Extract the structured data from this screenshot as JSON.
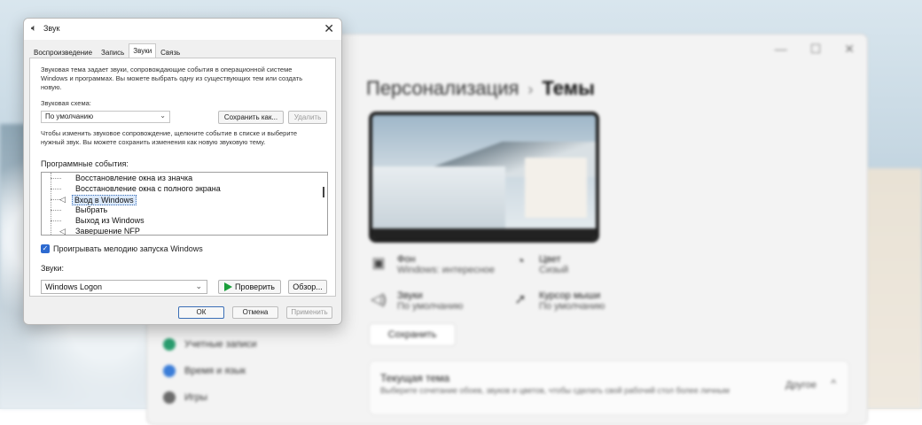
{
  "settings": {
    "breadcrumb_parent": "Персонализация",
    "breadcrumb_sep": "›",
    "breadcrumb_current": "Темы",
    "window_controls": [
      "—",
      "☐",
      "✕"
    ],
    "tiles": [
      {
        "title": "Фон",
        "value": "Windows: интересное",
        "icon": "image-icon"
      },
      {
        "title": "Цвет",
        "value": "Сизый",
        "icon": "palette-icon"
      },
      {
        "title": "Звуки",
        "value": "По умолчанию",
        "icon": "speaker-icon"
      },
      {
        "title": "Курсор мыши",
        "value": "По умолчанию",
        "icon": "cursor-icon"
      }
    ],
    "save_button": "Сохранить",
    "current_theme": {
      "title": "Текущая тема",
      "subtitle": "Выберите сочетание обоев, звуков и цветов, чтобы сделать свой рабочий стол более личным",
      "value": "Другое",
      "chevron": "^"
    },
    "nav": [
      {
        "label": "Учетные записи",
        "color": "#2a9d6f"
      },
      {
        "label": "Время и язык",
        "color": "#3b7dd8"
      },
      {
        "label": "Игры",
        "color": "#6b6b6b"
      }
    ]
  },
  "dialog": {
    "title": "Звук",
    "close_glyph": "✕",
    "tabs": [
      "Воспроизведение",
      "Запись",
      "Звуки",
      "Связь"
    ],
    "selected_tab": 2,
    "intro": "Звуковая тема задает звуки, сопровождающие события в операционной системе Windows и программах. Вы можете выбрать одну из существующих тем или создать новую.",
    "scheme_label": "Звуковая схема:",
    "scheme_value": "По умолчанию",
    "save_as": "Сохранить как...",
    "delete": "Удалить",
    "hint": "Чтобы изменить звуковое сопровождение, щелкните событие в списке и выберите нужный звук. Вы можете сохранить изменения как новую звуковую тему.",
    "events_label": "Программные события:",
    "events": [
      {
        "label": "Восстановление окна из значка",
        "has_sound": false,
        "selected": false
      },
      {
        "label": "Восстановление окна с полного экрана",
        "has_sound": false,
        "selected": false
      },
      {
        "label": "Вход в Windows",
        "has_sound": true,
        "selected": true
      },
      {
        "label": "Выбрать",
        "has_sound": false,
        "selected": false
      },
      {
        "label": "Выход из Windows",
        "has_sound": false,
        "selected": false
      },
      {
        "label": "Завершение NFP",
        "has_sound": true,
        "selected": false
      }
    ],
    "startup_checkbox": "Проигрывать мелодию запуска Windows",
    "startup_checked": true,
    "sounds_label": "Звуки:",
    "sound_value": "Windows Logon",
    "test_button": "Проверить",
    "browse_button": "Обзор...",
    "ok": "ОК",
    "cancel": "Отмена",
    "apply": "Применить"
  }
}
